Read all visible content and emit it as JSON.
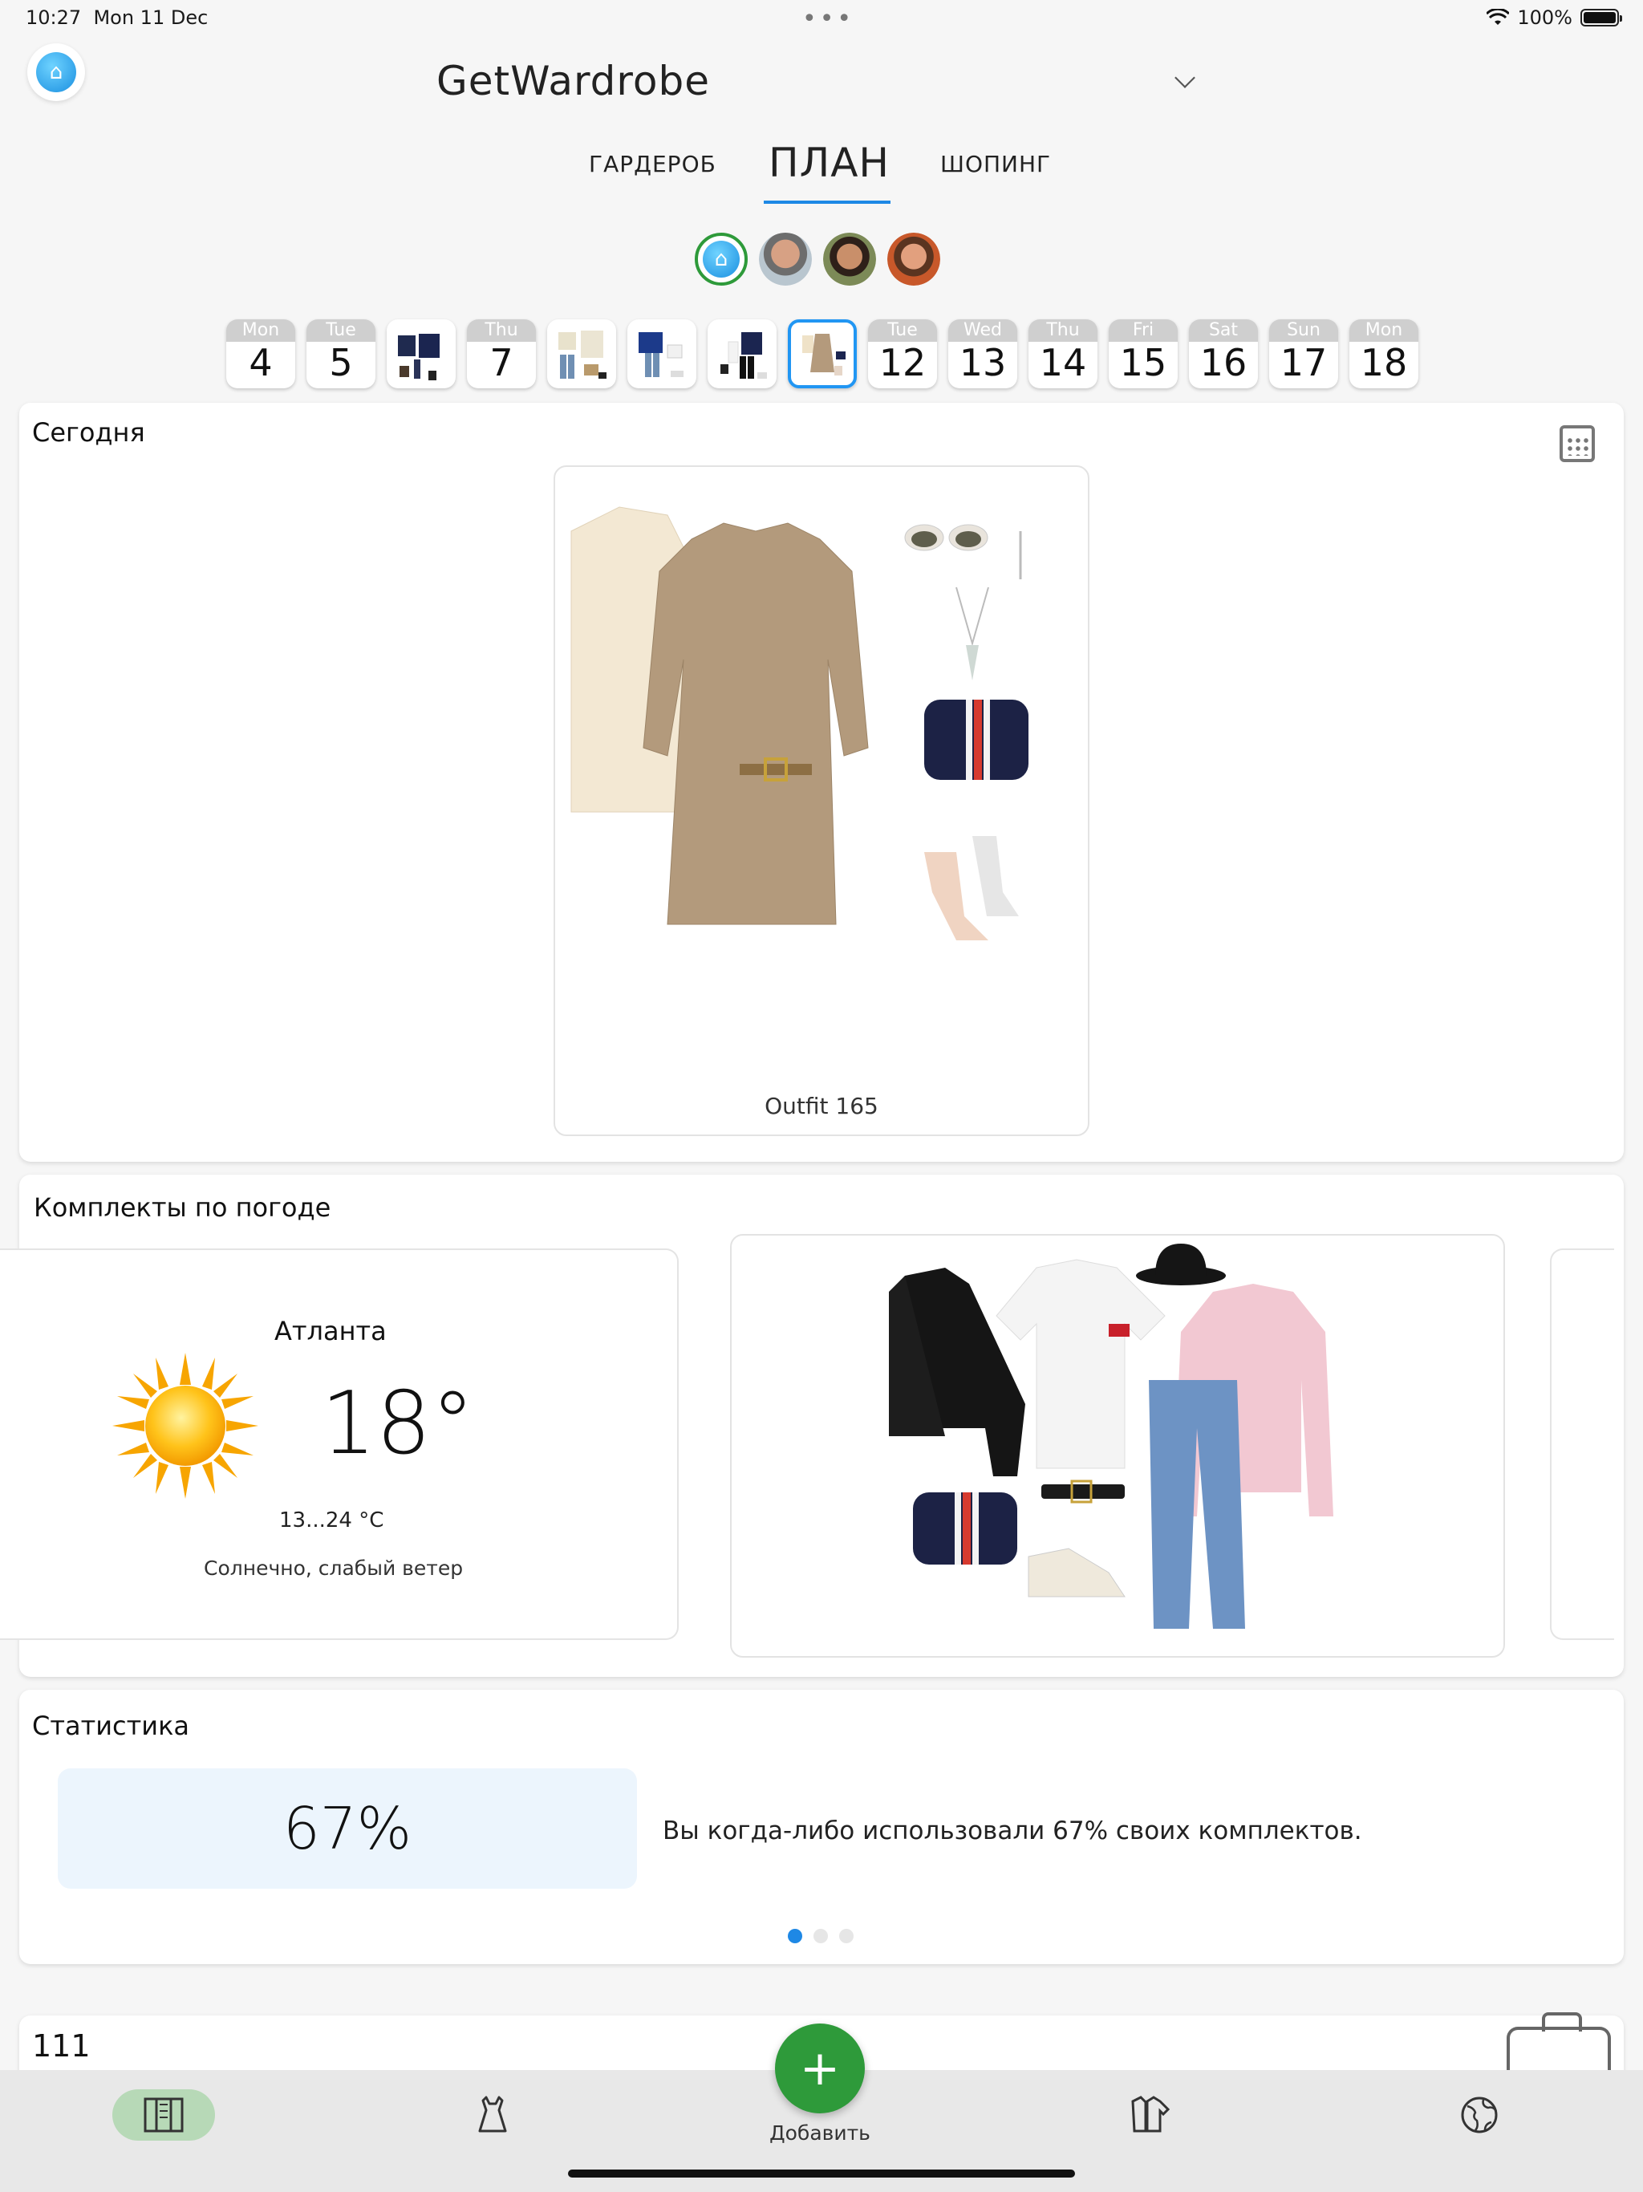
{
  "status_bar": {
    "time": "10:27",
    "date": "Mon 11 Dec",
    "battery": "100%"
  },
  "header": {
    "title": "GetWardrobe"
  },
  "tabs": [
    {
      "label": "ГАРДЕРОБ"
    },
    {
      "label": "ПЛАН"
    },
    {
      "label": "ШОПИНГ"
    }
  ],
  "days": [
    {
      "dow": "Mon",
      "num": "4"
    },
    {
      "dow": "Tue",
      "num": "5"
    },
    {
      "dow": "Tue",
      "num": "12"
    },
    {
      "dow": "Wed",
      "num": "13"
    },
    {
      "dow": "Thu",
      "num": "14"
    },
    {
      "dow": "Thu",
      "num": "7"
    },
    {
      "dow": "Fri",
      "num": "15"
    },
    {
      "dow": "Sat",
      "num": "16"
    },
    {
      "dow": "Sun",
      "num": "17"
    },
    {
      "dow": "Mon",
      "num": "18"
    }
  ],
  "today": {
    "title": "Сегодня",
    "outfit_name": "Outfit 165"
  },
  "weather": {
    "title": "Комплекты по погоде",
    "city": "Атланта",
    "temp": "18°",
    "range": "13...24 °C",
    "conditions": "Солнечно, слабый ветер"
  },
  "stats": {
    "title": "Статистика",
    "value": "67%",
    "text": "Вы когда-либо использовали 67% своих комплектов."
  },
  "next_section": {
    "title": "111"
  },
  "tabbar": {
    "add_label": "Добавить"
  },
  "colors": {
    "accent": "#1e88e5",
    "green": "#2e9a3a",
    "tabbar_active": "#b7d9b7"
  }
}
